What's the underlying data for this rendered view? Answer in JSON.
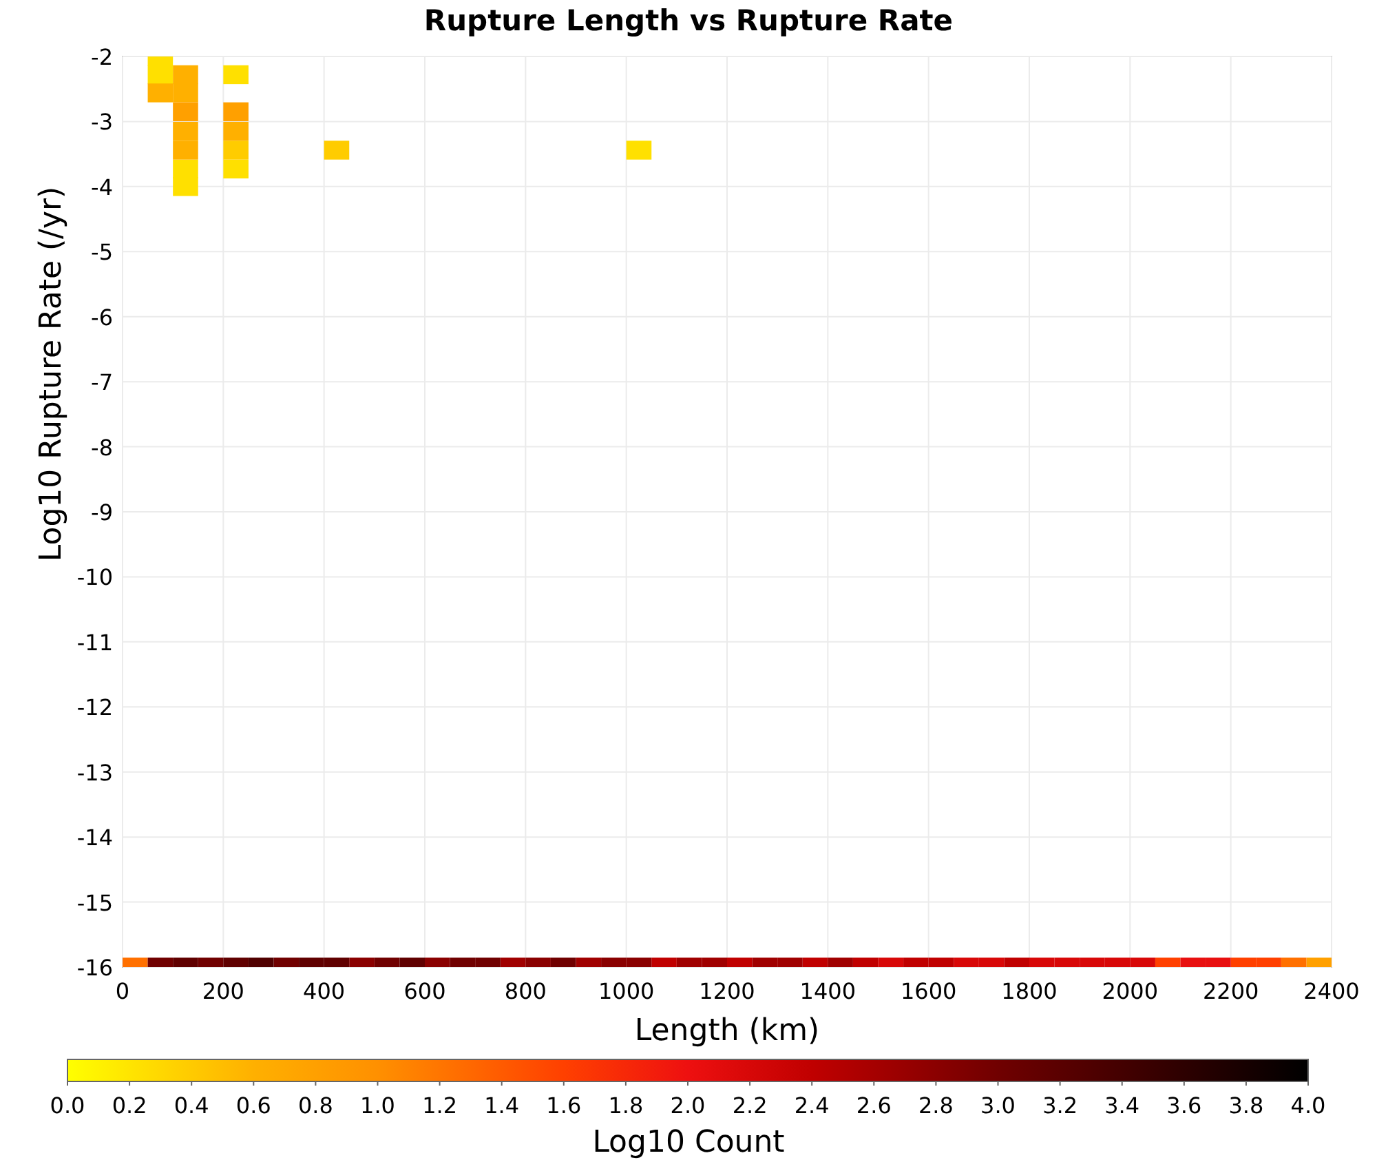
{
  "chart_data": {
    "type": "scatter",
    "title": "Rupture Length vs Rupture Rate",
    "xlabel": "Length (km)",
    "ylabel": "Log10 Rupture Rate (/yr)",
    "grid": true,
    "xlim": [
      0,
      2400
    ],
    "ylim": [
      -16,
      -2
    ],
    "xticks": [
      0,
      200,
      400,
      600,
      800,
      1000,
      1200,
      1400,
      1600,
      1800,
      2000,
      2200,
      2400
    ],
    "yticks": [
      -2,
      -3,
      -4,
      -5,
      -6,
      -7,
      -8,
      -9,
      -10,
      -11,
      -12,
      -13,
      -14,
      -15,
      -16
    ],
    "series": [
      {
        "color": "#ffe000",
        "x": [
          75,
          75,
          125,
          125,
          225,
          225,
          1025
        ],
        "values": [
          -2.0,
          -2.28,
          -3.73,
          -4.0,
          -2.28,
          -3.73,
          -3.44
        ]
      },
      {
        "color": "#ffcc00",
        "x": [
          225,
          425
        ],
        "values": [
          -3.44,
          -3.44
        ]
      },
      {
        "color": "#ffb000",
        "x": [
          75,
          125,
          125,
          125,
          125,
          225
        ],
        "values": [
          -2.56,
          -2.28,
          -2.56,
          -3.15,
          -3.44,
          -3.15
        ]
      },
      {
        "color": "#ffa000",
        "x": [
          125,
          225,
          2375
        ],
        "values": [
          -2.85,
          -2.85,
          -16
        ]
      },
      {
        "color": "#ff7000",
        "x": [
          25,
          2325
        ],
        "values": [
          -16,
          -16
        ]
      },
      {
        "color": "#ff4000",
        "x": [
          2075,
          2225,
          2275
        ],
        "values": [
          -16,
          -16,
          -16
        ]
      },
      {
        "color": "#e81010",
        "x": [
          2125,
          2175
        ],
        "values": [
          -16,
          -16
        ]
      },
      {
        "color": "#d80808",
        "x": [
          1525,
          1675,
          1725,
          1825,
          1875,
          1925,
          1975,
          2025
        ],
        "values": [
          -16,
          -16,
          -16,
          -16,
          -16,
          -16,
          -16,
          -16
        ]
      },
      {
        "color": "#c00000",
        "x": [
          1075,
          1225,
          1375,
          1475,
          1575,
          1625,
          1775
        ],
        "values": [
          -16,
          -16,
          -16,
          -16,
          -16,
          -16,
          -16
        ]
      },
      {
        "color": "#a00000",
        "x": [
          775,
          925,
          1125,
          1175,
          1275,
          1325,
          1425
        ],
        "values": [
          -16,
          -16,
          -16,
          -16,
          -16,
          -16,
          -16
        ]
      },
      {
        "color": "#8a0000",
        "x": [
          475,
          625,
          825,
          975,
          1025
        ],
        "values": [
          -16,
          -16,
          -16,
          -16,
          -16
        ]
      },
      {
        "color": "#700000",
        "x": [
          75,
          175,
          325,
          525,
          675,
          725,
          875
        ],
        "values": [
          -16,
          -16,
          -16,
          -16,
          -16,
          -16,
          -16
        ]
      },
      {
        "color": "#600000",
        "x": [
          125,
          225,
          375,
          425,
          575
        ],
        "values": [
          -16,
          -16,
          -16,
          -16,
          -16
        ]
      },
      {
        "color": "#500000",
        "x": [
          275
        ],
        "values": [
          -16
        ]
      }
    ]
  },
  "color_scale": {
    "label": "Log10 Count",
    "ticks": [
      "0.0",
      "0.2",
      "0.4",
      "0.6",
      "0.8",
      "1.0",
      "1.2",
      "1.4",
      "1.6",
      "1.8",
      "2.0",
      "2.2",
      "2.4",
      "2.6",
      "2.8",
      "3.0",
      "3.2",
      "3.4",
      "3.6",
      "3.8",
      "4.0"
    ]
  }
}
